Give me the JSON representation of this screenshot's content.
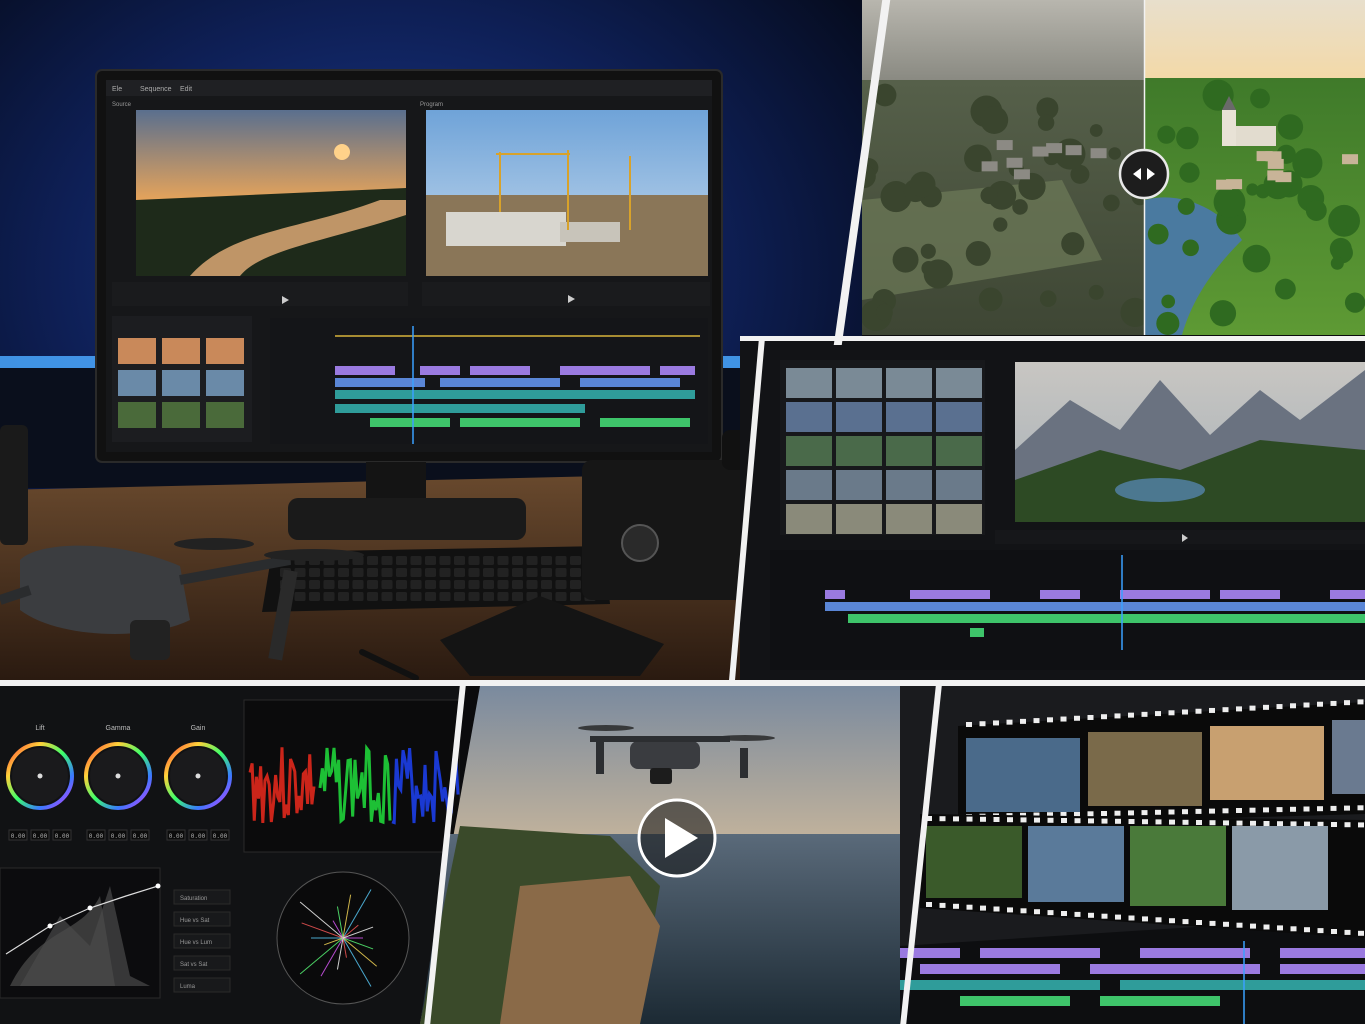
{
  "colors": {
    "bg": "#0b0b0d",
    "divider": "#f2f2f2",
    "ambient_blue": "#1b3f9a",
    "led_blue": "#4aa8ff",
    "clip_purple": "#9a7ae0",
    "clip_blue": "#5a86d6",
    "clip_teal": "#2f9c9a",
    "clip_green": "#3ec46a",
    "playhead": "#3aa0ff",
    "scope_red": "#e0281c",
    "scope_green": "#1fd43a",
    "scope_blue": "#1c3ee8"
  },
  "editor_monitor": {
    "tabs": [
      "Ele",
      "Sequence",
      "Edit"
    ],
    "source_label": "Source",
    "program_label": "Program"
  },
  "color_grading": {
    "wheel_labels": [
      "Lift",
      "Gamma",
      "Gain"
    ],
    "wheel_values": [
      [
        "0.00",
        "0.00",
        "0.00"
      ],
      [
        "0.00",
        "0.00",
        "0.00"
      ],
      [
        "0.00",
        "0.00",
        "0.00"
      ]
    ],
    "curve_options": [
      "Saturation",
      "Hue vs Sat",
      "Hue vs Lum",
      "Sat vs Sat",
      "Luma"
    ]
  },
  "icons": {
    "compare": "left-right-arrows-icon",
    "play": "play-icon"
  }
}
